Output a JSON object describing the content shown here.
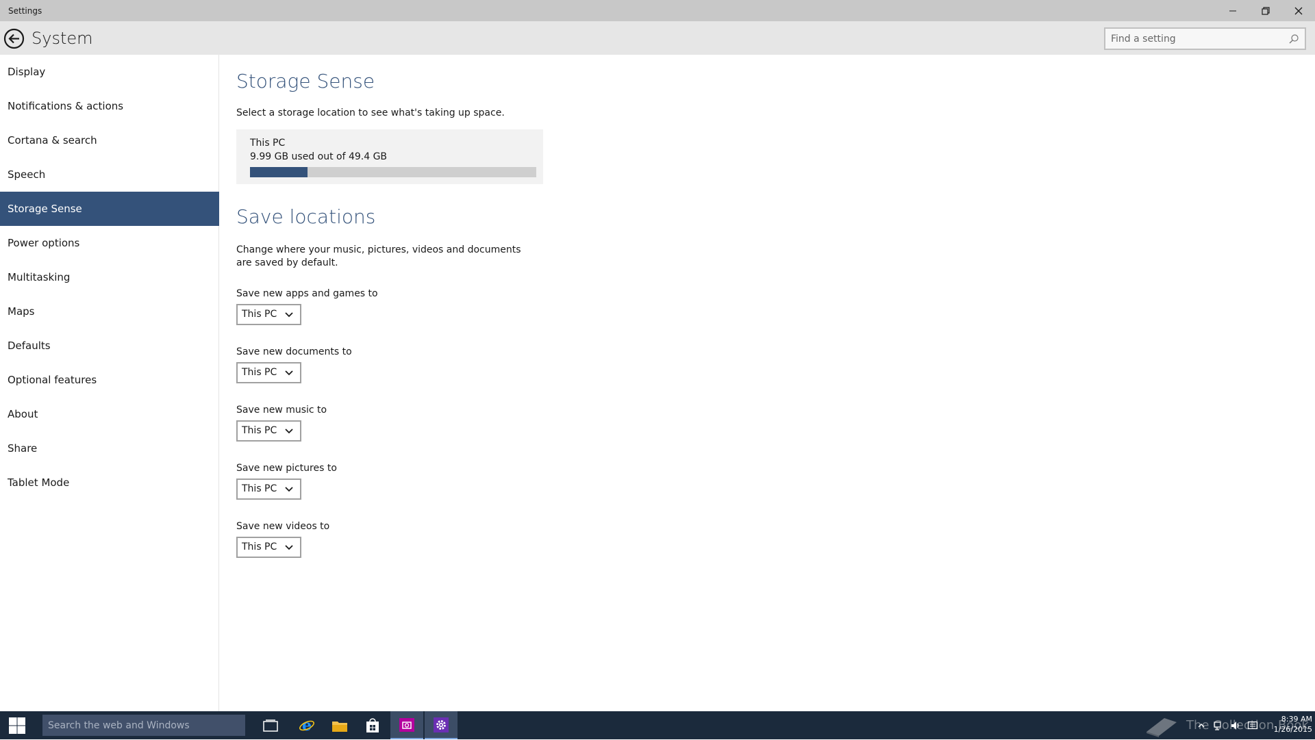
{
  "window": {
    "title": "Settings"
  },
  "header": {
    "title": "System",
    "search_placeholder": "Find a setting"
  },
  "sidebar": {
    "items": [
      {
        "label": "Display"
      },
      {
        "label": "Notifications & actions"
      },
      {
        "label": "Cortana & search"
      },
      {
        "label": "Speech"
      },
      {
        "label": "Storage Sense",
        "active": true
      },
      {
        "label": "Power options"
      },
      {
        "label": "Multitasking"
      },
      {
        "label": "Maps"
      },
      {
        "label": "Defaults"
      },
      {
        "label": "Optional features"
      },
      {
        "label": "About"
      },
      {
        "label": "Share"
      },
      {
        "label": "Tablet Mode"
      }
    ]
  },
  "storage": {
    "heading": "Storage Sense",
    "description": "Select a storage location to see what's taking up space.",
    "tile": {
      "name": "This PC",
      "usage": "9.99 GB used out of 49.4 GB",
      "used_fraction": 0.2
    }
  },
  "save_locations": {
    "heading": "Save locations",
    "description": "Change where your music, pictures, videos and documents are saved by default.",
    "settings": [
      {
        "label": "Save new apps and games to",
        "value": "This PC"
      },
      {
        "label": "Save new documents to",
        "value": "This PC"
      },
      {
        "label": "Save new music to",
        "value": "This PC"
      },
      {
        "label": "Save new pictures to",
        "value": "This PC"
      },
      {
        "label": "Save new videos to",
        "value": "This PC"
      }
    ]
  },
  "taskbar": {
    "search_placeholder": "Search the web and Windows",
    "apps": [
      "task-view-icon",
      "internet-explorer-icon",
      "file-explorer-icon",
      "store-icon",
      "camera-app-icon",
      "settings-app-icon"
    ],
    "watermark": "The Collection Book",
    "clock": {
      "time": "8:39 AM",
      "date": "1/26/2015"
    }
  },
  "colors": {
    "accent": "#34527a",
    "taskbar": "#1b2a3c"
  }
}
